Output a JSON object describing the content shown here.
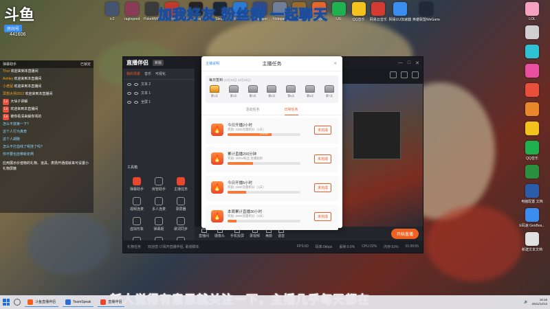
{
  "overlay": {
    "top_banner": "加我好友 粉丝群 一起聊天",
    "bottom_banner": "新人觉得有意思就关注一下，主播几乎每天都在"
  },
  "logo": {
    "mark": "斗鱼",
    "tag": "房间号",
    "room_id": "441606"
  },
  "desktop_top_icons": [
    {
      "label": "ic2",
      "color": "#44536f"
    },
    {
      "label": "ragingood",
      "color": "#8a3b55"
    },
    {
      "label": "PokeMMO",
      "color": "#3b3b3b"
    },
    {
      "label": "Cuphead",
      "color": "#c0392b"
    },
    {
      "label": "Epic Games Launcher",
      "color": "#222"
    },
    {
      "label": "Steam",
      "color": "#1b2838"
    },
    {
      "label": "WeGame",
      "color": "#2b7bd6"
    },
    {
      "label": "Wallpaper",
      "color": "#2f4a8a"
    },
    {
      "label": "Notepad",
      "color": "#6f7f9a"
    },
    {
      "label": "Hearth",
      "color": "#9a6b2a"
    },
    {
      "label": "Origin",
      "color": "#e8662a"
    },
    {
      "label": "UU",
      "color": "#1eb14e"
    },
    {
      "label": "QQ音乐",
      "color": "#f3c21b"
    },
    {
      "label": "网易云音乐",
      "color": "#d33a31"
    },
    {
      "label": "网易UU加速器",
      "color": "#3b8df0"
    },
    {
      "label": "英雄联盟WeGame版",
      "color": "#202a39"
    }
  ],
  "desktop_right_icons": [
    {
      "label": "LOL",
      "color": "#f4a0c0"
    },
    {
      "label": "",
      "color": "#cfcfcf"
    },
    {
      "label": "",
      "color": "#2ec2d3"
    },
    {
      "label": "",
      "color": "#e94fa0"
    },
    {
      "label": "",
      "color": "#e94f3b"
    },
    {
      "label": "",
      "color": "#e9872d"
    },
    {
      "label": "",
      "color": "#f3c21b"
    },
    {
      "label": "QQ音乐",
      "color": "#1eb14e"
    },
    {
      "label": "",
      "color": "#2a8f3e"
    },
    {
      "label": "电脑配置 文档",
      "color": "#2a5caa"
    },
    {
      "label": "E码速 GeoBea...",
      "color": "#3b8df0"
    },
    {
      "label": "新建文本文档",
      "color": "#e0e0e0"
    }
  ],
  "chat": {
    "header_left": "弹幕助手",
    "header_right": "已锁定",
    "messages": [
      {
        "nick": "Thor",
        "text": "欢迎来到本直播间",
        "badge": "",
        "sys": false
      },
      {
        "nick": "Ashley",
        "text": "欢迎来到本直播间",
        "badge": "",
        "sys": false
      },
      {
        "nick": "小老鼠",
        "text": "欢迎来到本直播间",
        "badge": "",
        "sys": false
      },
      {
        "nick": "冥想大师2012",
        "text": "欢迎来到本直播间",
        "badge": "",
        "sys": false
      },
      {
        "nick": "",
        "text": "大仙子讲解",
        "badge": "Lv",
        "sys": false
      },
      {
        "nick": "",
        "text": "欢迎来到本直播间",
        "badge": "Lv",
        "sys": false
      },
      {
        "nick": "",
        "text": "被你看清来解你骂的",
        "badge": "Lv",
        "sys": false
      },
      {
        "nick": "",
        "text": "怎么不放第一下?",
        "badge": "",
        "sys": true
      },
      {
        "nick": "",
        "text": "这个人行为真奇",
        "badge": "",
        "sys": true
      },
      {
        "nick": "",
        "text": "这个人胡跑",
        "badge": "",
        "sys": true
      },
      {
        "nick": "",
        "text": "怎么不打血线了呢挂了吗?",
        "badge": "",
        "sys": true
      },
      {
        "nick": "",
        "text": "你不要也自带新年啊",
        "badge": "",
        "sys": true
      }
    ],
    "notice": "应用展示价值物的礼物、道具、表扬开通成就来可设置小礼物屏蔽"
  },
  "host": {
    "app_name": "直播伴侣",
    "version": "新版",
    "tabs": [
      "我的场景",
      "音乐",
      "可视化"
    ],
    "scenes": [
      "文本 2",
      "文本 1",
      "全屏 1"
    ],
    "tools_title": "工具箱",
    "tools": [
      "弹幕助手",
      "房管助手",
      "主播任务",
      "视频连麦",
      "多人连麦",
      "录屏器",
      "虚拟形象",
      "弹幕姬",
      "歌词同步",
      "",
      "",
      ""
    ],
    "bottom_items": [
      "直播间",
      "摄像头",
      "手机投屏",
      "录视频",
      "美颜",
      "语音"
    ],
    "start_label": "开始直播",
    "status_items": [
      "礼物任务",
      "欢迎您·订阅开直播伴侣, 歌道脚本",
      "FPS:60",
      "码率:0kbps",
      "丢帧:0.0%",
      "CPU:22%",
      "内存:53%",
      "01:09:55"
    ]
  },
  "modal": {
    "tip": "主播说明",
    "title": "主播任务",
    "daily_title": "每日签到",
    "daily_range": "(12月13日-12月19日)",
    "days": [
      "第1天",
      "第2天",
      "第3天",
      "第4天",
      "第5天",
      "第6天",
      "第7天"
    ],
    "tabs": [
      "活动任务",
      "日常任务"
    ],
    "tasks": [
      {
        "name": "今日开播2小时",
        "reward": "奖励: 1000流量积分（1天）",
        "progress": 0.6,
        "progress_text": "120/180",
        "status": "未完成"
      },
      {
        "name": "累计直播200分钟",
        "reward": "奖励: 200%粉丝 主播组别",
        "progress": 0.35,
        "progress_text": "",
        "status": "未完成"
      },
      {
        "name": "今日开播5小时",
        "reward": "奖励: 1500流量积分（1天）",
        "progress": 0.25,
        "progress_text": "",
        "status": "未完成"
      },
      {
        "name": "本周累计直播30小时",
        "reward": "奖励: 2000流量积分（3天）",
        "progress": 0.12,
        "progress_text": "",
        "status": "未完成"
      }
    ]
  },
  "taskbar": {
    "apps": [
      {
        "label": "斗鱼直播伴侣",
        "color": "#f06020"
      },
      {
        "label": "TeamSpeak",
        "color": "#2b6ed1"
      },
      {
        "label": "直播伴侣",
        "color": "#e9472d"
      }
    ],
    "time": "18:18",
    "date": "2021/12/13"
  }
}
